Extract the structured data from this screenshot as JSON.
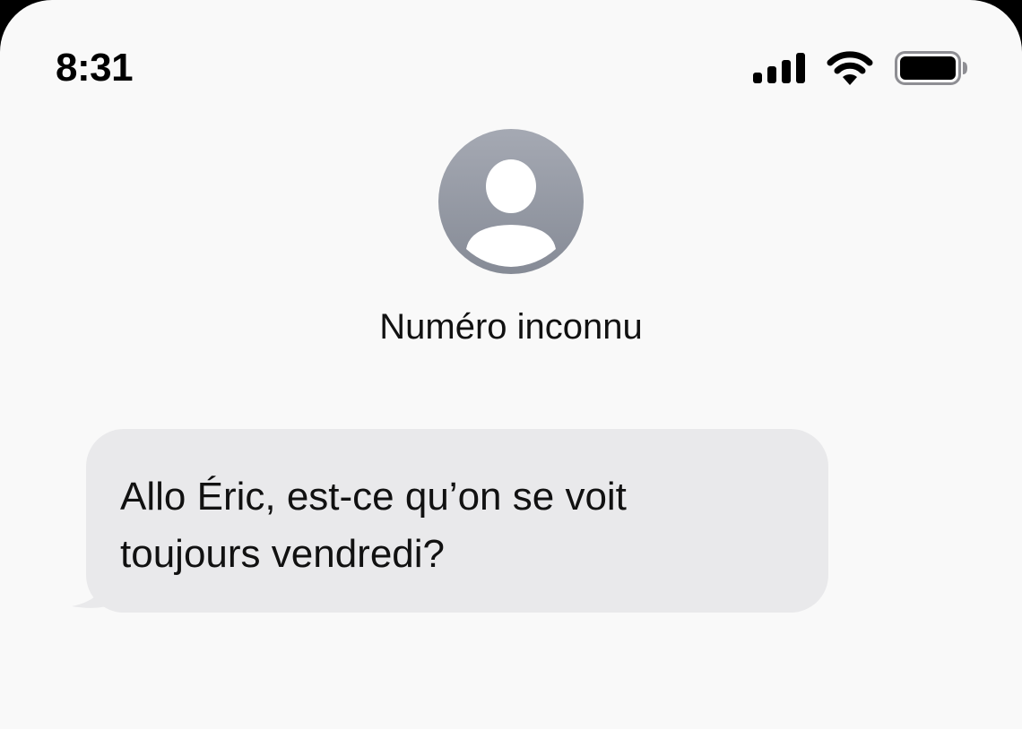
{
  "status_bar": {
    "time": "8:31",
    "icons": [
      "cellular-signal-icon",
      "wifi-icon",
      "battery-icon"
    ]
  },
  "contact": {
    "name": "Numéro inconnu",
    "avatar_icon": "person-placeholder-icon"
  },
  "messages": [
    {
      "direction": "incoming",
      "text": "Allo Éric, est-ce qu’on se voit\ntoujours vendredi?"
    }
  ],
  "colors": {
    "background": "#f9f9f9",
    "incoming_bubble": "#e9e9eb",
    "avatar_top": "#a5a9b3",
    "avatar_bottom": "#868b96"
  }
}
